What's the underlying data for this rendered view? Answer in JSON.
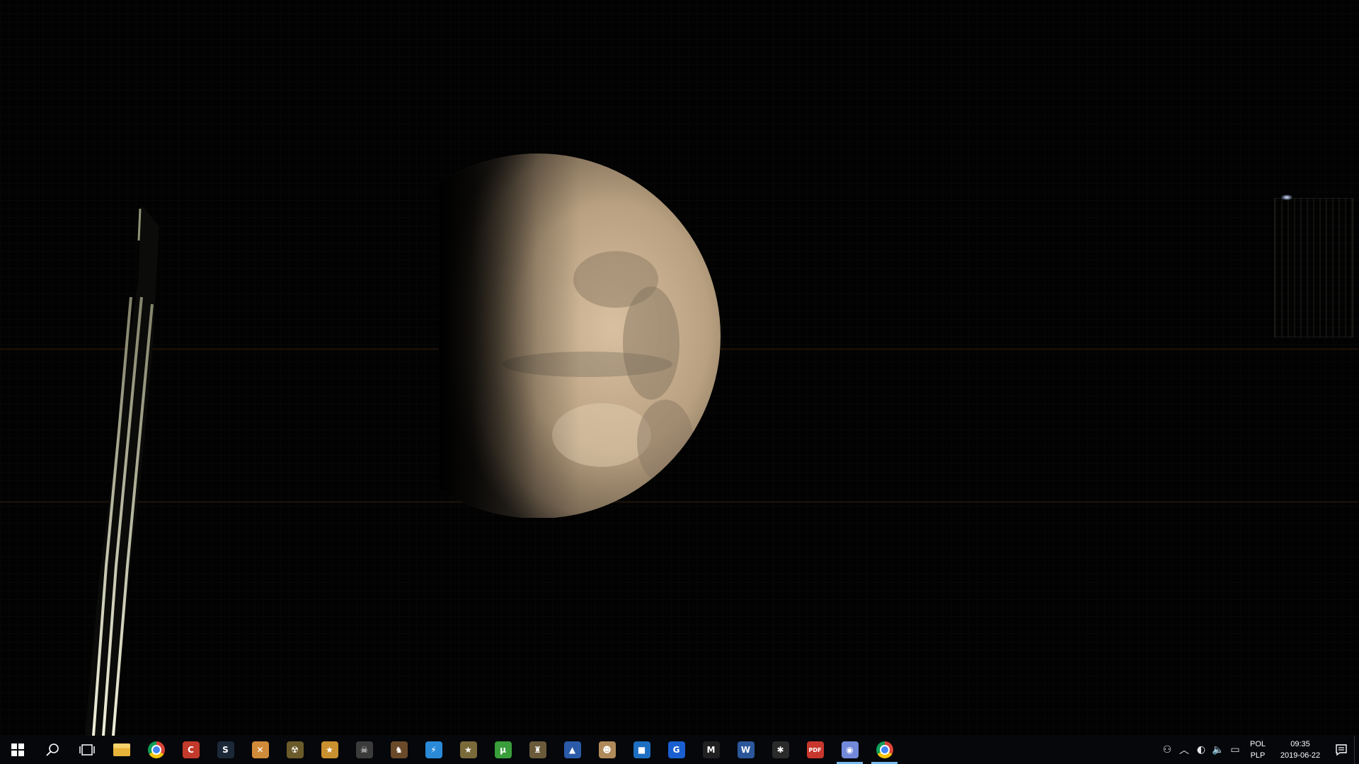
{
  "desktop": {
    "wallpaper": "mars-photo"
  },
  "taskbar": {
    "accent": "#76b9ed",
    "start": {
      "icon": "windows-logo-icon"
    },
    "search": {
      "icon": "search-icon"
    },
    "task_view": {
      "icon": "task-view-icon"
    },
    "apps": [
      {
        "name": "file-explorer",
        "icon": "folder-icon",
        "glyph": "",
        "color": "#e8b43a",
        "active": false
      },
      {
        "name": "chrome",
        "icon": "chrome-icon",
        "glyph": "",
        "color": "#dd4b39",
        "active": false
      },
      {
        "name": "ccleaner",
        "icon": "ccleaner-icon",
        "glyph": "C",
        "color": "#c23a2b",
        "active": false
      },
      {
        "name": "steam",
        "icon": "steam-icon",
        "glyph": "S",
        "color": "#1b2838",
        "active": false
      },
      {
        "name": "tools",
        "icon": "tools-icon",
        "glyph": "✕",
        "color": "#d08b3a",
        "active": false
      },
      {
        "name": "radiation",
        "icon": "radiation-icon",
        "glyph": "☢",
        "color": "#6b5b2a",
        "active": false
      },
      {
        "name": "game-one",
        "icon": "game-icon",
        "glyph": "★",
        "color": "#c9902f",
        "active": false
      },
      {
        "name": "game-two",
        "icon": "skull-icon",
        "glyph": "☠",
        "color": "#3b3b3b",
        "active": false
      },
      {
        "name": "game-three",
        "icon": "warrior-icon",
        "glyph": "♞",
        "color": "#6b4a2a",
        "active": false
      },
      {
        "name": "bolt-app",
        "icon": "lightning-icon",
        "glyph": "⚡",
        "color": "#2a8ad8",
        "active": false
      },
      {
        "name": "star-app",
        "icon": "star-icon",
        "glyph": "★",
        "color": "#7a6a3a",
        "active": false
      },
      {
        "name": "utorrent",
        "icon": "utorrent-icon",
        "glyph": "µ",
        "color": "#3a9e3a",
        "active": false
      },
      {
        "name": "game-four",
        "icon": "castle-icon",
        "glyph": "♜",
        "color": "#6a5a3a",
        "active": false
      },
      {
        "name": "launcher",
        "icon": "launcher-icon",
        "glyph": "▲",
        "color": "#2a5aa8",
        "active": false
      },
      {
        "name": "character-app",
        "icon": "face-icon",
        "glyph": "☻",
        "color": "#b08a5a",
        "active": false
      },
      {
        "name": "window-app",
        "icon": "window-icon",
        "glyph": "■",
        "color": "#1e6fc2",
        "active": false
      },
      {
        "name": "g-app",
        "icon": "g-logo-icon",
        "glyph": "G",
        "color": "#1a5fd0",
        "active": false
      },
      {
        "name": "m-app",
        "icon": "m-logo-icon",
        "glyph": "M",
        "color": "#202020",
        "active": false
      },
      {
        "name": "word",
        "icon": "word-icon",
        "glyph": "W",
        "color": "#2b579a",
        "active": false
      },
      {
        "name": "spider-app",
        "icon": "spider-icon",
        "glyph": "✱",
        "color": "#2a2a2a",
        "active": false
      },
      {
        "name": "pdf-app",
        "icon": "pdf-icon",
        "glyph": "PDF",
        "color": "#c8372d",
        "active": false
      },
      {
        "name": "discord",
        "icon": "discord-icon",
        "glyph": "◉",
        "color": "#7289da",
        "active": true
      },
      {
        "name": "chrome-2",
        "icon": "chrome-icon",
        "glyph": "",
        "color": "#dd4b39",
        "active": true
      }
    ],
    "tray": {
      "icons": [
        "people-icon",
        "chevron-up-icon",
        "steam-tray-icon",
        "volume-icon",
        "network-icon"
      ],
      "glyphs": [
        "⚇",
        "︿",
        "◐",
        "🔈",
        "▭"
      ],
      "language_top": "POL",
      "language_bottom": "PLP",
      "time": "09:35",
      "date": "2019-06-22"
    }
  }
}
